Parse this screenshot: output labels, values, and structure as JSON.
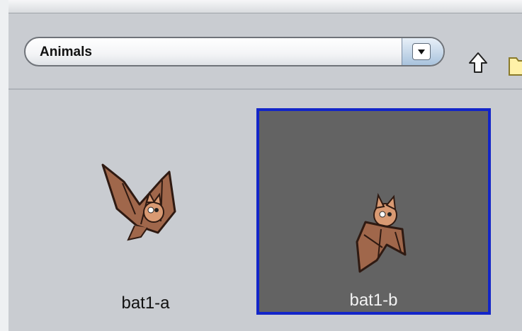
{
  "toolbar": {
    "category_label": "Animals"
  },
  "icons": {
    "dropdown": "chevron-down-icon",
    "up": "up-arrow-icon",
    "folder": "folder-icon"
  },
  "costumes": [
    {
      "name": "bat1-a",
      "selected": false
    },
    {
      "name": "bat1-b",
      "selected": true
    }
  ],
  "colors": {
    "selection_border": "#1325c8",
    "selected_background": "#636363",
    "background": "#c9ccd1"
  }
}
